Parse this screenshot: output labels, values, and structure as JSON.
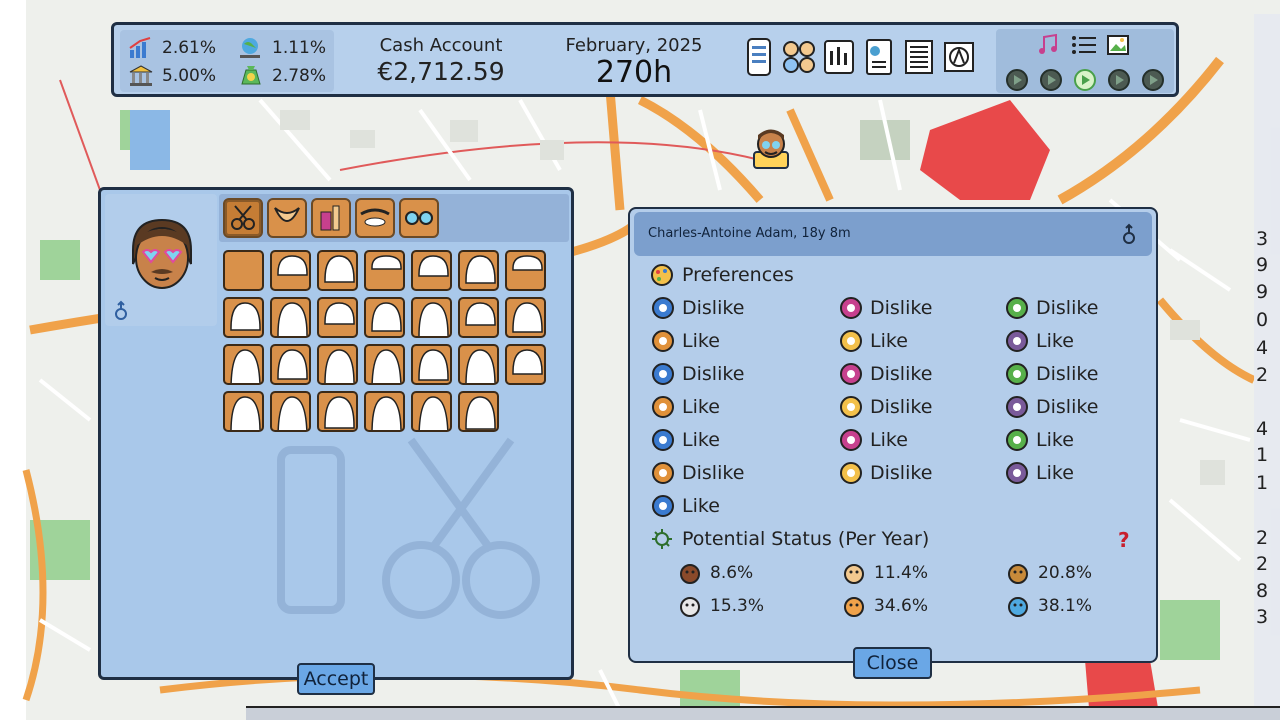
{
  "hud": {
    "stat_top_left": "2.61%",
    "stat_bottom_left": "5.00%",
    "stat_top_right": "1.11%",
    "stat_bottom_right": "2.78%",
    "cash_label": "Cash Account",
    "cash_value": "€2,712.59",
    "date_label": "February, 2025",
    "time_value": "270h",
    "menu_icons": [
      "phone-icon",
      "people-icon",
      "stocks-icon",
      "document-chart-icon",
      "newspaper-icon",
      "license-icon"
    ],
    "top_right_icons": [
      "music-icon",
      "list-icon",
      "picture-icon"
    ],
    "speed_controls": [
      "pause",
      "play",
      "fast",
      "faster",
      "fastest"
    ],
    "active_speed": "fast"
  },
  "hair_editor": {
    "tabs": [
      "hair-cut-icon",
      "beard-icon",
      "makeup-icon",
      "eyebrow-icon",
      "glasses-icon"
    ],
    "selected_tab": "hair-cut-icon",
    "accept_label": "Accept",
    "gender_icon": "male-symbol-icon"
  },
  "character": {
    "name": "Charles-Antoine Adam, 18y 8m",
    "gender_icon": "male-symbol-icon",
    "preferences_title": "Preferences",
    "preferences": [
      {
        "icon": "clock-icon",
        "label": "Dislike"
      },
      {
        "icon": "network-icon",
        "label": "Dislike"
      },
      {
        "icon": "dumbbell-icon",
        "label": "Dislike"
      },
      {
        "icon": "food-icon",
        "label": "Like"
      },
      {
        "icon": "sleep-moon-icon",
        "label": "Like"
      },
      {
        "icon": "books-icon",
        "label": "Like"
      },
      {
        "icon": "slippers-icon",
        "label": "Dislike"
      },
      {
        "icon": "celebration-icon",
        "label": "Dislike"
      },
      {
        "icon": "chat-icon",
        "label": "Dislike"
      },
      {
        "icon": "garden-bench-icon",
        "label": "Like"
      },
      {
        "icon": "badge-icon",
        "label": "Dislike"
      },
      {
        "icon": "painting-icon",
        "label": "Dislike"
      },
      {
        "icon": "hygiene-icon",
        "label": "Like"
      },
      {
        "icon": "diamond-icon",
        "label": "Like"
      },
      {
        "icon": "car-icon",
        "label": "Like"
      },
      {
        "icon": "shopping-bag-icon",
        "label": "Dislike"
      },
      {
        "icon": "coffee-bean-icon",
        "label": "Dislike"
      },
      {
        "icon": "bottles-icon",
        "label": "Like"
      },
      {
        "icon": "flower-icon",
        "label": "Like"
      }
    ],
    "status_title": "Potential Status (Per Year)",
    "help_icon": "question-mark-icon",
    "statuses": [
      {
        "icon": "bug-icon",
        "value": "8.6%"
      },
      {
        "icon": "head-stress-icon",
        "value": "11.4%"
      },
      {
        "icon": "hamster-icon",
        "value": "20.8%"
      },
      {
        "icon": "ghost-icon",
        "value": "15.3%"
      },
      {
        "icon": "pizza-icon",
        "value": "34.6%"
      },
      {
        "icon": "alert-person-icon",
        "value": "38.1%"
      }
    ],
    "close_label": "Close"
  },
  "background_peek": {
    "right_digits": [
      "3",
      "9",
      "9",
      "0",
      "4",
      "2",
      "4",
      "1",
      "1",
      "2",
      "2",
      "8",
      "3"
    ]
  },
  "colors": {
    "panel_blue": "#a9c8ea",
    "header_blue": "#7c9fcd",
    "button_blue": "#6aa7e6",
    "swatch_orange": "#d9914a"
  }
}
